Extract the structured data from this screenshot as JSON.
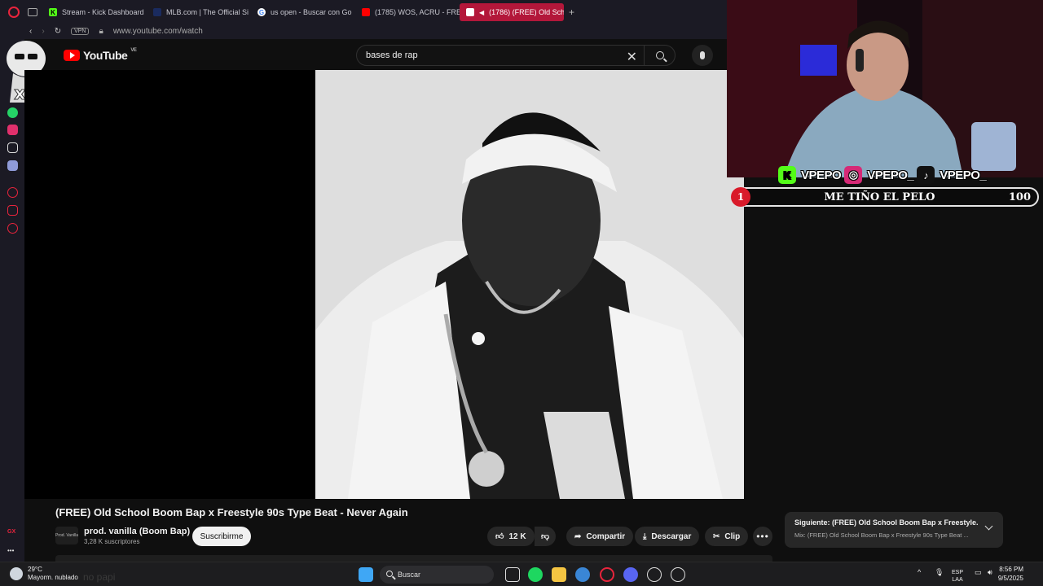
{
  "browser": {
    "tabs": [
      {
        "label": "Stream - Kick Dashboard",
        "fav_color": "#53fc18",
        "fav_glyph": "K",
        "active": false
      },
      {
        "label": "MLB.com | The Official Si",
        "fav_color": "#1a2b5f",
        "fav_glyph": "",
        "active": false
      },
      {
        "label": "us open - Buscar con Go",
        "fav_color": "#ffffff",
        "fav_glyph": "G",
        "active": false
      },
      {
        "label": "(1785) WOS, ACRU - FREE",
        "fav_color": "#ff0000",
        "fav_glyph": "",
        "active": false
      },
      {
        "label": "(1786) (FREE) Old Sch",
        "fav_color": "#ff0000",
        "fav_glyph": "",
        "active": true
      }
    ],
    "new_tab": "+",
    "vpn_label": "VPN",
    "url": "www.youtube.com/watch"
  },
  "youtube": {
    "logo_text": "YouTube",
    "region": "VE",
    "search_query": "bases de rap"
  },
  "video": {
    "title": "(FREE) Old School Boom Bap x Freestyle 90s Type Beat - Never Again",
    "channel_name": "prod. vanilla (Boom Bap)",
    "channel_avatar_text": "Prod. Vanilla",
    "subscribers": "3,28 K suscriptores",
    "subscribe_label": "Suscribirme",
    "likes": "12 K",
    "share_label": "Compartir",
    "download_label": "Descargar",
    "clip_label": "Clip",
    "more_label": "•••"
  },
  "next_up": {
    "title": "Siguiente: (FREE) Old School Boom Bap x Freestyle...",
    "subtitle": "Mix: (FREE) Old School Boom Bap x Freestyle 90s Type Beat ..."
  },
  "stream_overlay": {
    "handles": [
      "VPEPO",
      "VPEPO_",
      "VPEPO_"
    ],
    "goal_number": "1",
    "goal_text": "ME TIÑO EL PELO",
    "goal_value": "100",
    "accent": "#d91a2a"
  },
  "taskbar": {
    "temperature": "29°C",
    "weather": "Mayorm. nublado",
    "search_label": "Buscar",
    "lang_top": "ESP",
    "lang_bottom": "LAA",
    "time": "8:56 PM",
    "date": "9/5/2025",
    "ghost_text": "no papi"
  }
}
